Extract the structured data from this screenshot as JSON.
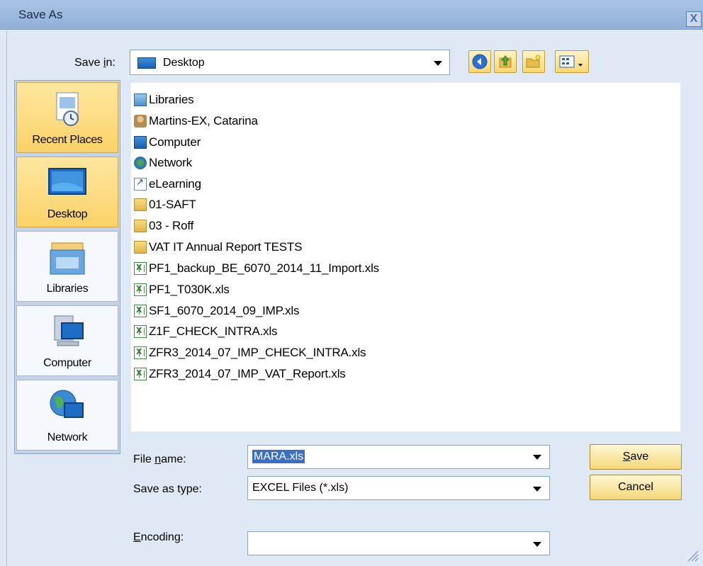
{
  "window": {
    "title": "Save As",
    "close_glyph": "X"
  },
  "save_in": {
    "label_pre": "Save ",
    "label_key": "i",
    "label_post": "n:",
    "value": "Desktop"
  },
  "toolbar": {
    "icons": [
      "back-icon",
      "up-folder-icon",
      "new-folder-icon",
      "view-menu-icon"
    ]
  },
  "places": [
    {
      "label": "Recent Places",
      "icon": "recent-places-icon",
      "highlighted": true
    },
    {
      "label": "Desktop",
      "icon": "desktop-icon",
      "highlighted": true
    },
    {
      "label": "Libraries",
      "icon": "libraries-icon",
      "highlighted": false
    },
    {
      "label": "Computer",
      "icon": "computer-icon",
      "highlighted": false
    },
    {
      "label": "Network",
      "icon": "network-icon",
      "highlighted": false
    }
  ],
  "files": [
    {
      "name": "Libraries",
      "icon": "library"
    },
    {
      "name": "Martins-EX, Catarina",
      "icon": "user"
    },
    {
      "name": "Computer",
      "icon": "computer"
    },
    {
      "name": "Network",
      "icon": "network"
    },
    {
      "name": "eLearning",
      "icon": "shortcut"
    },
    {
      "name": "01-SAFT",
      "icon": "folder"
    },
    {
      "name": "03 - Roff",
      "icon": "folder"
    },
    {
      "name": "VAT IT Annual Report TESTS",
      "icon": "folder"
    },
    {
      "name": "PF1_backup_BE_6070_2014_11_Import.xls",
      "icon": "excel"
    },
    {
      "name": "PF1_T030K.xls",
      "icon": "excel"
    },
    {
      "name": "SF1_6070_2014_09_IMP.xls",
      "icon": "excel"
    },
    {
      "name": "Z1F_CHECK_INTRA.xls",
      "icon": "excel"
    },
    {
      "name": "ZFR3_2014_07_IMP_CHECK_INTRA.xls",
      "icon": "excel"
    },
    {
      "name": "ZFR3_2014_07_IMP_VAT_Report.xls",
      "icon": "excel"
    }
  ],
  "file_name": {
    "label_pre": "File ",
    "label_key": "n",
    "label_post": "ame:",
    "value": "MARA.xls"
  },
  "save_as_type": {
    "label": "Save as type:",
    "value": "EXCEL Files (*.xls)"
  },
  "encoding": {
    "label_key": "E",
    "label_post": "ncoding:",
    "value": ""
  },
  "buttons": {
    "save_key": "S",
    "save_rest": "ave",
    "cancel": "Cancel"
  }
}
